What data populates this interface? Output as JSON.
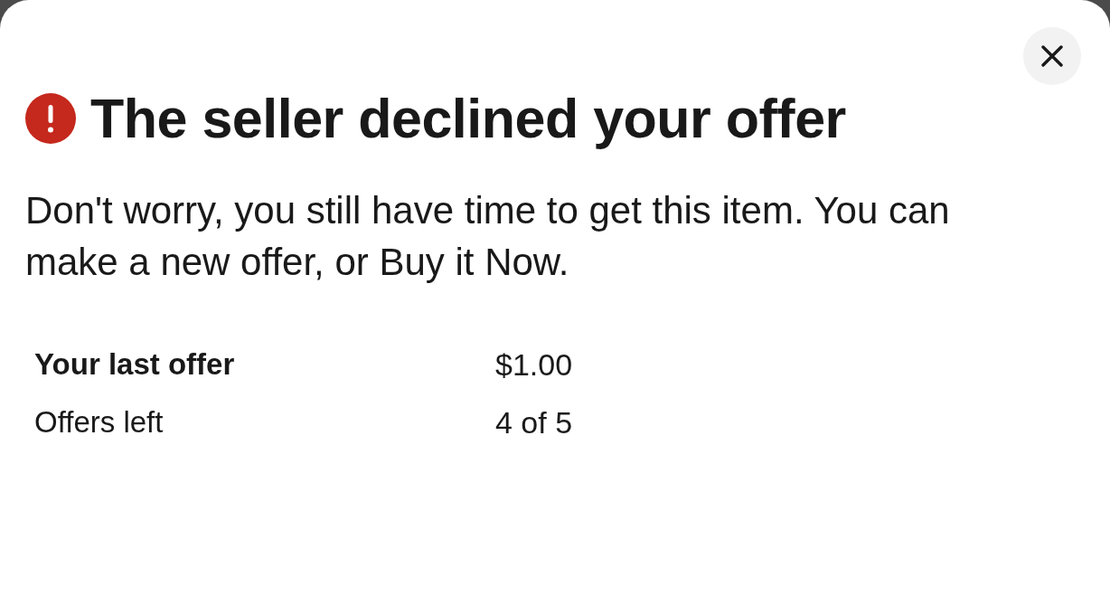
{
  "dialog": {
    "title": "The seller declined your offer",
    "message": "Don't worry, you still have time to get this item. You can make a new offer, or Buy it Now.",
    "details": [
      {
        "kind": "strong",
        "label": "Your last offer",
        "value": "$1.00"
      },
      {
        "kind": "plain",
        "label": "Offers left",
        "value": "4 of 5"
      }
    ]
  }
}
